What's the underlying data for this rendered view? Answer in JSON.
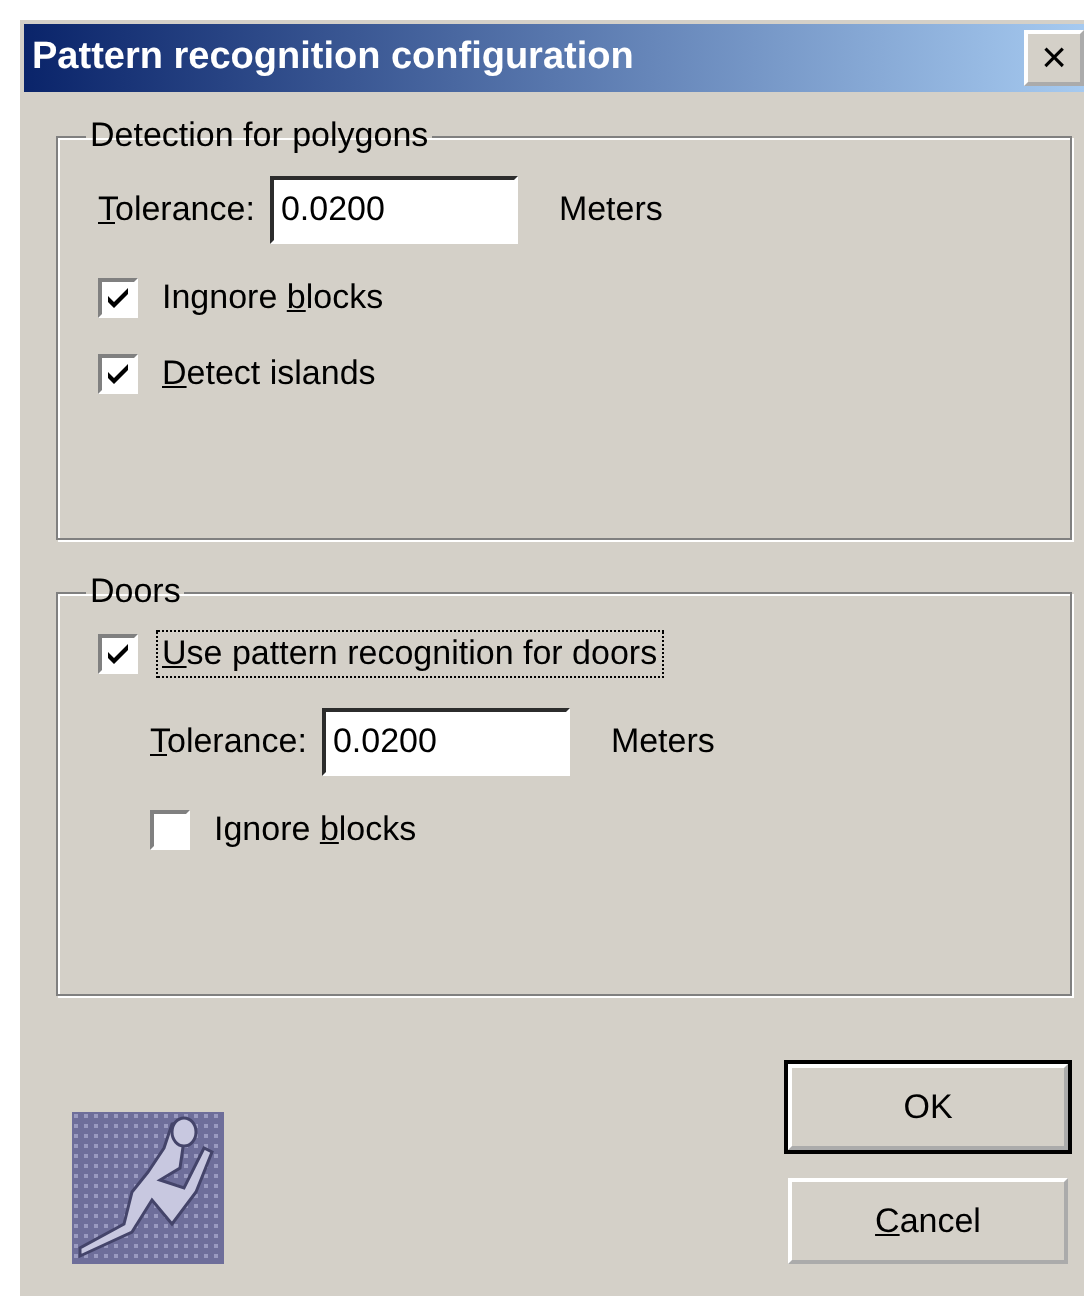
{
  "window": {
    "title": "Pattern recognition configuration",
    "close": "×"
  },
  "groups": [
    {
      "title": "Detection for polygons",
      "items": [
        {
          "kind": "field",
          "label": {
            "key": "T",
            "after": "olerance:"
          },
          "value": "0.0200",
          "unit": "Meters"
        },
        {
          "kind": "checkbox",
          "label": {
            "before": "Ingnore ",
            "key": "b",
            "after": "locks"
          },
          "checked": true,
          "focused": false
        },
        {
          "kind": "checkbox",
          "label": {
            "key": "D",
            "after": "etect islands"
          },
          "checked": true,
          "focused": false
        }
      ]
    },
    {
      "title": "Doors",
      "items": [
        {
          "kind": "checkbox",
          "label": {
            "key": "U",
            "after": "se pattern recognition for doors"
          },
          "checked": true,
          "focused": true
        },
        {
          "kind": "field",
          "label": {
            "key": "T",
            "after": "olerance:"
          },
          "value": "0.0200",
          "unit": "Meters",
          "indent": true
        },
        {
          "kind": "checkbox",
          "label": {
            "before": "Ignore ",
            "key": "b",
            "after": "locks"
          },
          "checked": false,
          "focused": false,
          "indent": true
        }
      ]
    }
  ],
  "buttons": [
    {
      "label": {
        "after": "OK"
      },
      "default": true
    },
    {
      "label": {
        "key": "C",
        "after": "ancel"
      },
      "default": false
    }
  ]
}
